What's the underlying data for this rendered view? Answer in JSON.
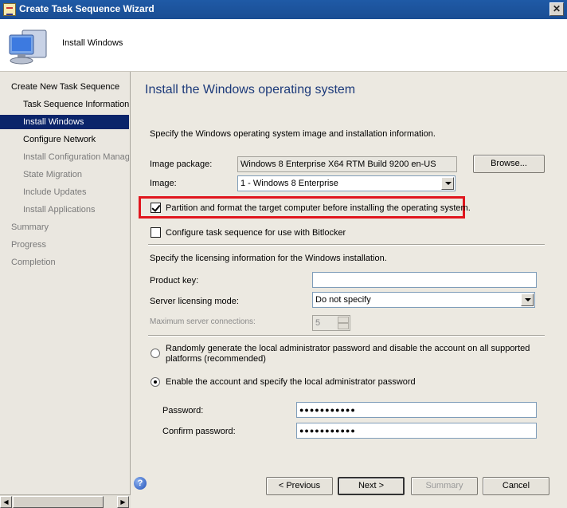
{
  "window": {
    "title": "Create Task Sequence Wizard",
    "close_glyph": "✕"
  },
  "header": {
    "title": "Install Windows"
  },
  "nav": {
    "items": [
      {
        "label": "Create New Task Sequence"
      },
      {
        "label": "Task Sequence Information"
      },
      {
        "label": "Install Windows"
      },
      {
        "label": "Configure Network"
      },
      {
        "label": "Install Configuration Manag"
      },
      {
        "label": "State Migration"
      },
      {
        "label": "Include Updates"
      },
      {
        "label": "Install Applications"
      },
      {
        "label": "Summary"
      },
      {
        "label": "Progress"
      },
      {
        "label": "Completion"
      }
    ]
  },
  "main": {
    "title": "Install the Windows operating system",
    "intro": "Specify the Windows operating system image and installation information.",
    "image_package_label": "Image package:",
    "image_package_value": "Windows 8 Enterprise X64 RTM Build 9200 en-US",
    "browse_label": "Browse...",
    "image_label": "Image:",
    "image_value": "1 - Windows 8 Enterprise",
    "partition_label": "Partition and format the target computer before installing the operating system.",
    "partition_checked": true,
    "bitlocker_label": "Configure task sequence for use with Bitlocker",
    "bitlocker_checked": false,
    "licensing_intro": "Specify the licensing information for the Windows installation.",
    "product_key_label": "Product key:",
    "product_key_value": "",
    "server_mode_label": "Server licensing mode:",
    "server_mode_value": "Do not specify",
    "max_conn_label": "Maximum server connections:",
    "max_conn_value": "5",
    "radio_random_label_1": "Randomly generate the local administrator password and disable the account on all supported",
    "radio_random_label_2": "platforms (recommended)",
    "radio_enable_label": "Enable the account and specify the local administrator password",
    "password_label": "Password:",
    "password_value": "●●●●●●●●●●●",
    "confirm_label": "Confirm password:",
    "confirm_value": "●●●●●●●●●●●"
  },
  "footer": {
    "help_glyph": "?",
    "previous_label": "< Previous",
    "next_label": "Next >",
    "summary_label": "Summary",
    "cancel_label": "Cancel"
  },
  "colors": {
    "accent": "#0a246a",
    "title_text": "#1c3a7a",
    "highlight": "#e0161e"
  }
}
